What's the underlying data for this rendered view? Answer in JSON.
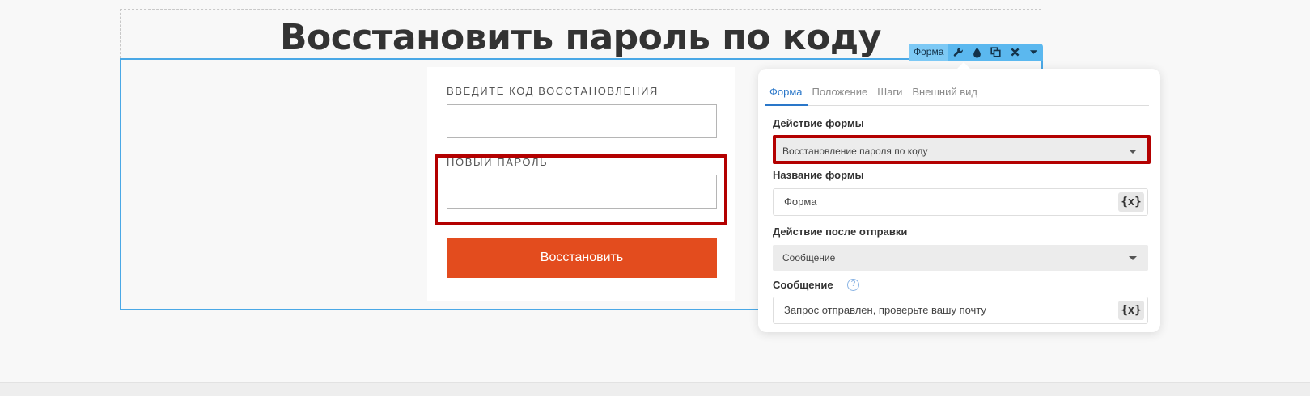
{
  "page": {
    "heading": "Восстановить пароль по коду"
  },
  "form": {
    "code_label": "ВВЕДИТЕ КОД ВОССТАНОВЛЕНИЯ",
    "code_value": "",
    "password_label": "НОВЫЙ ПАРОЛЬ",
    "password_value": "",
    "submit_label": "Восстановить"
  },
  "toolbar": {
    "label": "Форма",
    "icons": [
      "wrench-icon",
      "drop-icon",
      "duplicate-icon",
      "close-icon",
      "chevron-down-icon"
    ]
  },
  "panel": {
    "tabs": [
      {
        "label": "Форма",
        "active": true
      },
      {
        "label": "Положение",
        "active": false
      },
      {
        "label": "Шаги",
        "active": false
      },
      {
        "label": "Внешний вид",
        "active": false
      }
    ],
    "form_action_label": "Действие формы",
    "form_action_value": "Восстановление пароля по коду",
    "form_name_label": "Название формы",
    "form_name_value": "Форма",
    "after_submit_label": "Действие после отправки",
    "after_submit_value": "Сообщение",
    "message_label": "Сообщение",
    "message_value": "Запрос отправлен, проверьте вашу почту",
    "var_button_label": "{x}",
    "help_label": "?"
  },
  "colors": {
    "accent": "#e34c1e",
    "selection_blue": "#4aa8e6",
    "toolbar_blue": "#5bb8ef",
    "highlight_red": "#b30000",
    "tab_active": "#2a77c9"
  }
}
